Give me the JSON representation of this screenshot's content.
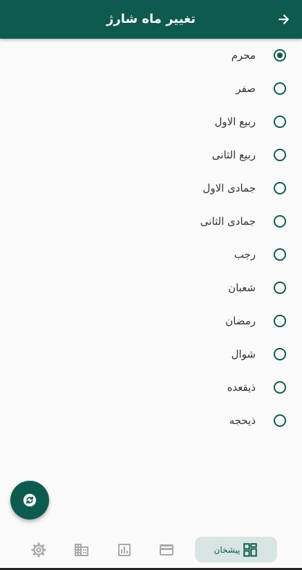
{
  "appbar": {
    "title": "تغییر ماه شارژ",
    "back_icon": "arrow-right-icon"
  },
  "months": [
    {
      "label": "محرم",
      "selected": true
    },
    {
      "label": "صفر",
      "selected": false
    },
    {
      "label": "ربیع الاول",
      "selected": false
    },
    {
      "label": "ربیع الثانی",
      "selected": false
    },
    {
      "label": "جمادی الاول",
      "selected": false
    },
    {
      "label": "جمادی الثانی",
      "selected": false
    },
    {
      "label": "رجب",
      "selected": false
    },
    {
      "label": "شعبان",
      "selected": false
    },
    {
      "label": "رمضان",
      "selected": false
    },
    {
      "label": "شوال",
      "selected": false
    },
    {
      "label": "ذیقعده",
      "selected": false
    },
    {
      "label": "ذیحجه",
      "selected": false
    }
  ],
  "fab": {
    "icon": "refresh-icon"
  },
  "bottom_nav": {
    "dashboard_label": "پیشخان",
    "items": [
      "dashboard-icon",
      "credit-card-icon",
      "bar-chart-icon",
      "building-icon",
      "settings-icon"
    ]
  },
  "colors": {
    "primary": "#0d5a4f",
    "active_bg": "#d8e5e3",
    "inactive_icon": "#a8a8a8"
  }
}
